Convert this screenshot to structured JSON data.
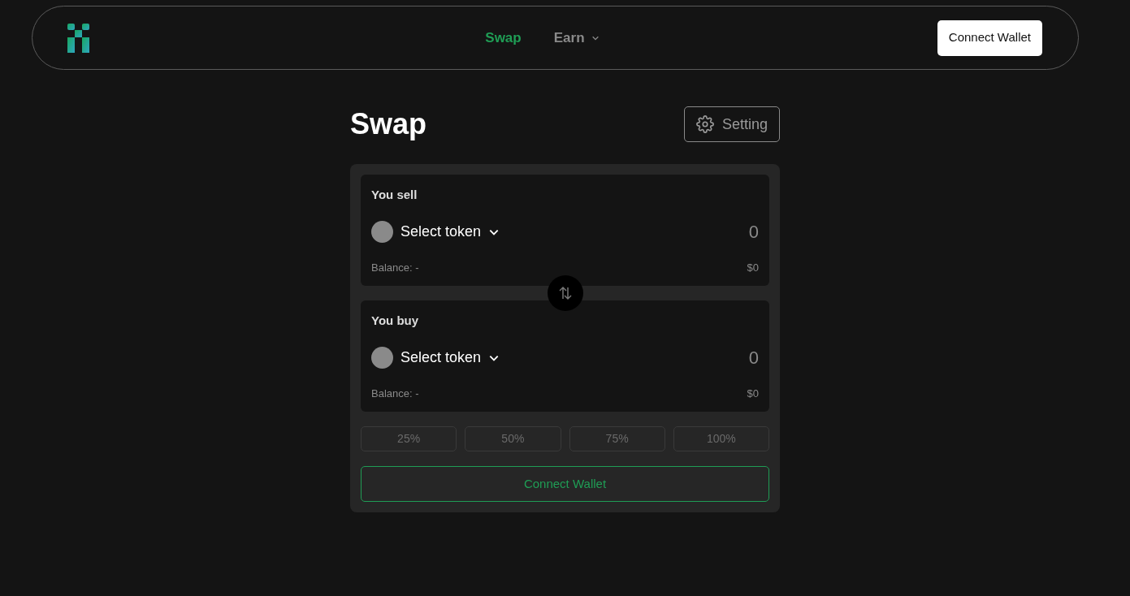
{
  "nav": {
    "items": [
      {
        "label": "Swap",
        "selected": true,
        "dropdown": false
      },
      {
        "label": "Earn",
        "selected": false,
        "dropdown": true
      }
    ],
    "connect_button": "Connect Wallet"
  },
  "page": {
    "title": "Swap",
    "settings_button": "Setting"
  },
  "panels": [
    {
      "label": "You sell",
      "token": "Select token",
      "amount": "0",
      "balance": "Balance: -",
      "value": "$0"
    },
    {
      "label": "You buy",
      "token": "Select token",
      "amount": "0",
      "balance": "Balance: -",
      "value": "$0"
    }
  ],
  "percent_buttons": [
    {
      "label": "25%",
      "disabled": true
    },
    {
      "label": "50%",
      "disabled": true
    },
    {
      "label": "75%",
      "disabled": true
    },
    {
      "label": "100%",
      "disabled": true
    }
  ],
  "action_button": "Connect Wallet"
}
